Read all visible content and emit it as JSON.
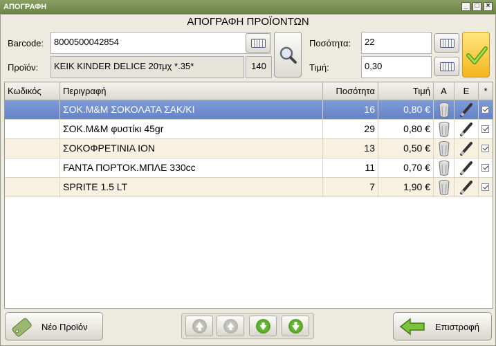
{
  "window": {
    "title": "ΑΠΟΓΡΑΦΗ"
  },
  "header": {
    "title": "ΑΠΟΓΡΑΦΗ ΠΡΟΪΟΝΤΩΝ"
  },
  "form": {
    "barcode_label": "Barcode:",
    "barcode_value": "8000500042854",
    "product_label": "Προϊόν:",
    "product_value": "ΚΕΙΚ KINDER DELICE 20τμχ *.35*",
    "product_count": "140",
    "quantity_label": "Ποσότητα:",
    "quantity_value": "22",
    "price_label": "Τιμή:",
    "price_value": "0,30"
  },
  "table": {
    "columns": [
      "Κωδικός",
      "Περιγραφή",
      "Ποσότητα",
      "Τιμή",
      "A",
      "E",
      "*"
    ],
    "rows": [
      {
        "code": "",
        "description": "ΣΟΚ.Μ&Μ ΣΟΚΟΛΑΤΑ ΣΑΚ/ΚΙ",
        "quantity": "16",
        "price": "0,80 €"
      },
      {
        "code": "",
        "description": "ΣΟΚ.Μ&Μ φυστίκι 45gr",
        "quantity": "29",
        "price": "0,80 €"
      },
      {
        "code": "",
        "description": "ΣΟΚΟΦΡΕΤΙΝΙΑ ΙΟΝ",
        "quantity": "13",
        "price": "0,50 €"
      },
      {
        "code": "",
        "description": "FANTA  ΠΟΡΤΟΚ.ΜΠΛΕ 330cc",
        "quantity": "11",
        "price": "0,70 €"
      },
      {
        "code": "",
        "description": "SPRITE 1.5 LT",
        "quantity": "7",
        "price": "1,90 €"
      }
    ]
  },
  "footer": {
    "new_product_label": "Νέο Προϊόν",
    "back_label": "Επιστροφή"
  },
  "colors": {
    "titlebar": "#6b8444",
    "selected_row": "#6f8dd0",
    "alt_row": "#f8f1e1",
    "confirm": "#8bc23a"
  }
}
